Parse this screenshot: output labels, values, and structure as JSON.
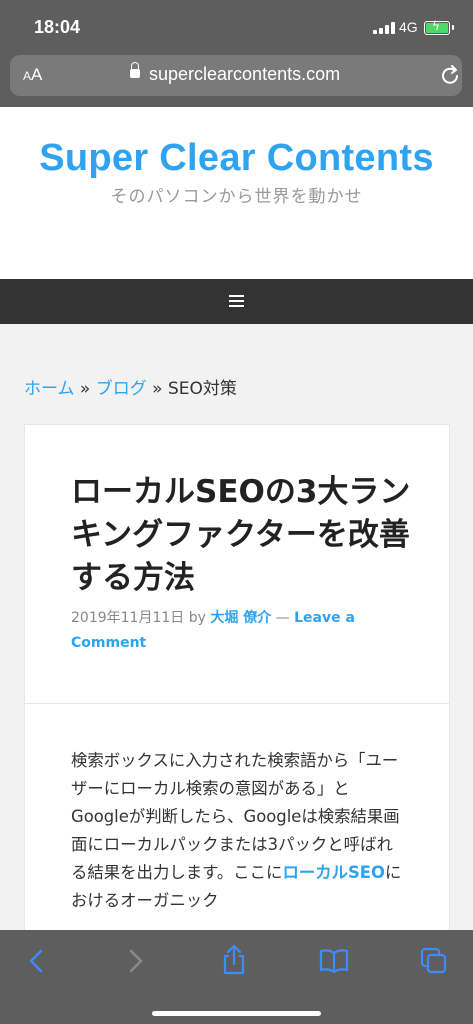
{
  "status": {
    "time": "18:04",
    "network": "4G"
  },
  "browser": {
    "text_size_small": "A",
    "text_size_large": "A",
    "domain": "superclearcontents.com"
  },
  "site": {
    "title": "Super Clear Contents",
    "tagline": "そのパソコンから世界を動かせ"
  },
  "breadcrumb": {
    "home": "ホーム",
    "sep": " » ",
    "blog": "ブログ",
    "current": "SEO対策"
  },
  "post": {
    "title": "ローカルSEOの3大ランキングファクターを改善する方法",
    "date": "2019年11月11日",
    "by": " by ",
    "author": "大堀 僚介",
    "dash": " — ",
    "comment": "Leave a Comment",
    "body_1": "検索ボックスに入力された検索語から「ユーザーにローカル検索の意図がある」とGoogleが判断したら、Googleは検索結果画面にローカルパックまたは3パックと呼ばれる結果を出力します。ここに",
    "body_link": "ローカルSEO",
    "body_2": "におけるオーガニック"
  },
  "toolbar": {
    "back_icon": "chevron-left-icon",
    "forward_icon": "chevron-right-icon",
    "share_icon": "share-icon",
    "bookmarks_icon": "book-icon",
    "tabs_icon": "tabs-icon"
  },
  "colors": {
    "accent": "#2ea3f2",
    "chrome": "#5e5e5e",
    "nav": "#333333"
  }
}
